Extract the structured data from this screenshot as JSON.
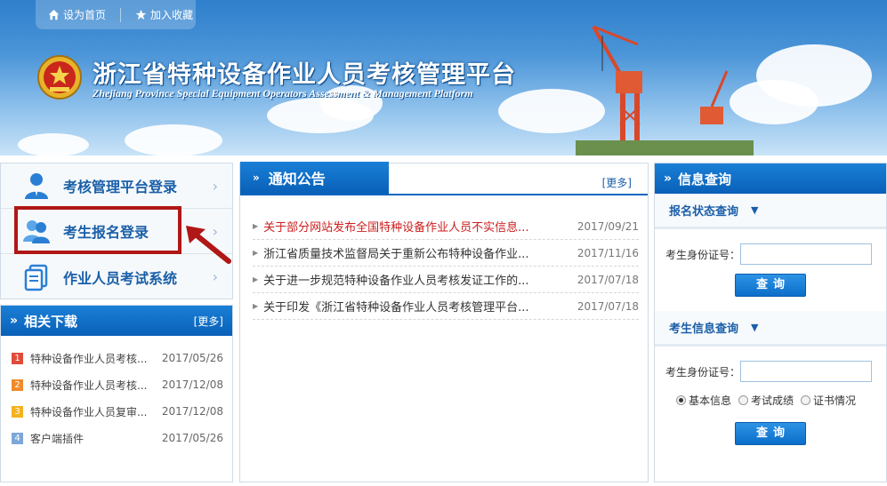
{
  "header": {
    "set_home": "设为首页",
    "bookmark": "加入收藏",
    "title": "浙江省特种设备作业人员考核管理平台",
    "subtitle": "Zhejiang Province Special Equipment Operators Assessment & Management Platform"
  },
  "login": {
    "items": [
      {
        "label": "考核管理平台登录"
      },
      {
        "label": "考生报名登录"
      },
      {
        "label": "作业人员考试系统"
      }
    ]
  },
  "downloads": {
    "title": "相关下载",
    "more": "[更多]",
    "items": [
      {
        "num": "1",
        "title": "特种设备作业人员考核...",
        "date": "2017/05/26",
        "color": "#e04b3a"
      },
      {
        "num": "2",
        "title": "特种设备作业人员考核...",
        "date": "2017/12/08",
        "color": "#f08a2c"
      },
      {
        "num": "3",
        "title": "特种设备作业人员复审...",
        "date": "2017/12/08",
        "color": "#f3b21f"
      },
      {
        "num": "4",
        "title": "客户端插件",
        "date": "2017/05/26",
        "color": "#7da7d9"
      }
    ]
  },
  "notices": {
    "title": "通知公告",
    "more": "[更多]",
    "items": [
      {
        "title": "关于部分网站发布全国特种设备作业人员不实信息...",
        "date": "2017/09/21",
        "red": true
      },
      {
        "title": "浙江省质量技术监督局关于重新公布特种设备作业...",
        "date": "2017/11/16",
        "red": false
      },
      {
        "title": "关于进一步规范特种设备作业人员考核发证工作的...",
        "date": "2017/07/18",
        "red": false
      },
      {
        "title": "关于印发《浙江省特种设备作业人员考核管理平台...",
        "date": "2017/07/18",
        "red": false
      }
    ]
  },
  "query": {
    "title": "信息查询",
    "signup_status": {
      "title": "报名状态查询",
      "id_label": "考生身份证号：",
      "id_value": "",
      "button": "查询"
    },
    "candidate_info": {
      "title": "考生信息查询",
      "id_label": "考生身份证号：",
      "id_value": "",
      "options": [
        {
          "label": "基本信息",
          "selected": true
        },
        {
          "label": "考试成绩",
          "selected": false
        },
        {
          "label": "证书情况",
          "selected": false
        }
      ],
      "button": "查询"
    }
  },
  "colors": {
    "accent": "#0b66bf",
    "highlight": "#b01717",
    "link": "#1a5fa8",
    "notice_red": "#cc1e1e"
  }
}
